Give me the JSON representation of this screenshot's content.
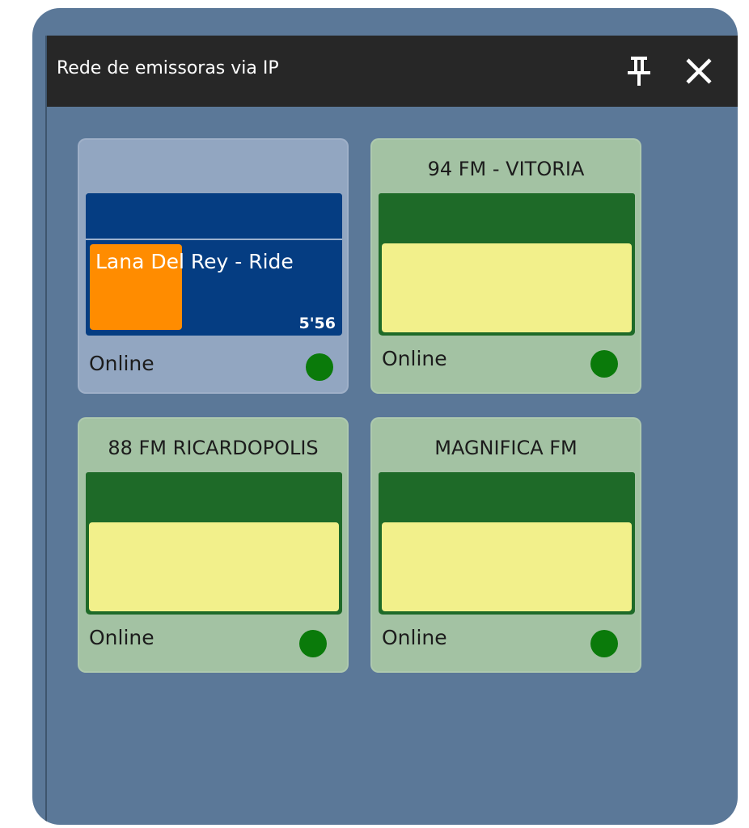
{
  "window": {
    "title": "Rede de emissoras via IP",
    "pin_icon": "pin-icon",
    "close_icon": "close-icon"
  },
  "colors": {
    "background": "#5b7898",
    "titlebar": "#272727",
    "active_card": "#92a6c1",
    "idle_card": "#a3c2a3",
    "station_bar": "#1e6a28",
    "text_box": "#f2f08b",
    "player": "#053d82",
    "progress": "#ff8c00",
    "status_online": "#0a7a0a"
  },
  "stations": [
    {
      "name": "",
      "song": "Lana Del Rey - Ride",
      "duration": "5'56",
      "progress": 0.37,
      "status": "Online",
      "status_icon": "status-dot-icon"
    },
    {
      "name": "94 FM - VITORIA",
      "status": "Online",
      "status_icon": "status-dot-icon"
    },
    {
      "name": "88 FM RICARDOPOLIS",
      "status": "Online",
      "status_icon": "status-dot-icon"
    },
    {
      "name": "MAGNIFICA FM",
      "status": "Online",
      "status_icon": "status-dot-icon"
    }
  ]
}
